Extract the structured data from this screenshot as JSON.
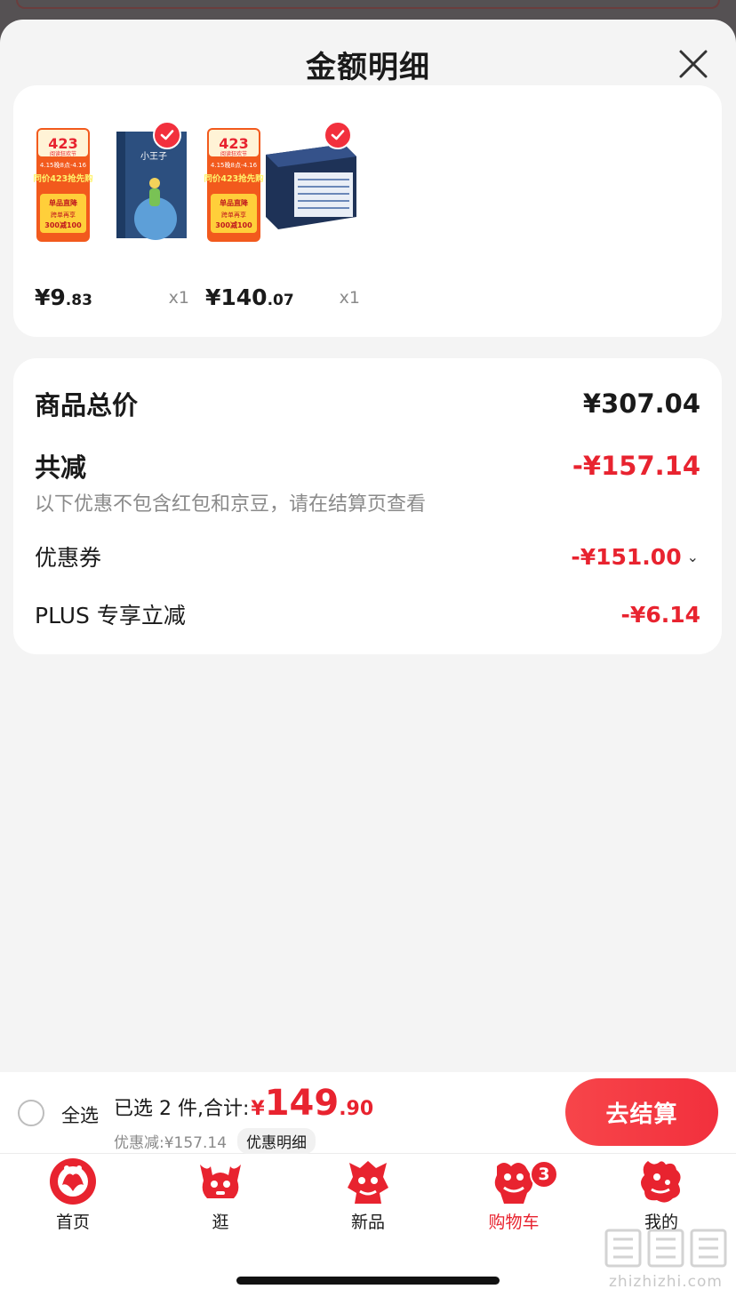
{
  "sheet": {
    "title": "金额明细"
  },
  "items": [
    {
      "badge_top": "423",
      "badge_caption": "阅读狂欢节",
      "promo_date": "4.15晚8点-4.16",
      "promo_title": "同价423抢先购",
      "promo_sub": "单品直降",
      "promo_deal": "跨单再享",
      "promo_amount": "300减100",
      "cover_title": "小王子",
      "price_int": "¥9",
      "price_dec": ".83",
      "qty": "x1"
    },
    {
      "badge_top": "423",
      "badge_caption": "阅读狂欢节",
      "promo_date": "4.15晚8点-4.16",
      "promo_title": "同价423抢先购",
      "promo_sub": "单品直降",
      "promo_deal": "跨单再享",
      "promo_amount": "300减100",
      "cover_title": "",
      "price_int": "¥140",
      "price_dec": ".07",
      "qty": "x1"
    }
  ],
  "details": {
    "total_label": "商品总价",
    "total_value": "¥307.04",
    "reduce_label": "共减",
    "reduce_value": "-¥157.14",
    "note": "以下优惠不包含红包和京豆，请在结算页查看",
    "coupon_label": "优惠券",
    "coupon_value": "-¥151.00",
    "plus_label": "PLUS 专享立减",
    "plus_value": "-¥6.14"
  },
  "bottom": {
    "select_all": "全选",
    "selected_text": "已选 2 件,合计:",
    "yen": "¥",
    "total_int": "149",
    "total_dec": ".90",
    "discount_text": "优惠减:¥157.14",
    "detail_tag": "优惠明细",
    "checkout_label": "去结算"
  },
  "tabs": [
    {
      "label": "首页",
      "icon": "home-papercut-icon"
    },
    {
      "label": "逛",
      "icon": "browse-papercut-icon"
    },
    {
      "label": "新品",
      "icon": "new-papercut-icon"
    },
    {
      "label": "购物车",
      "icon": "cart-papercut-icon",
      "active": true,
      "badge": "3"
    },
    {
      "label": "我的",
      "icon": "me-papercut-icon"
    }
  ],
  "watermark": {
    "site": "zhizhizhi.com"
  },
  "colors": {
    "accent": "#e8232f",
    "background": "#f4f4f4",
    "card": "#ffffff",
    "muted": "#8a8a8a"
  }
}
